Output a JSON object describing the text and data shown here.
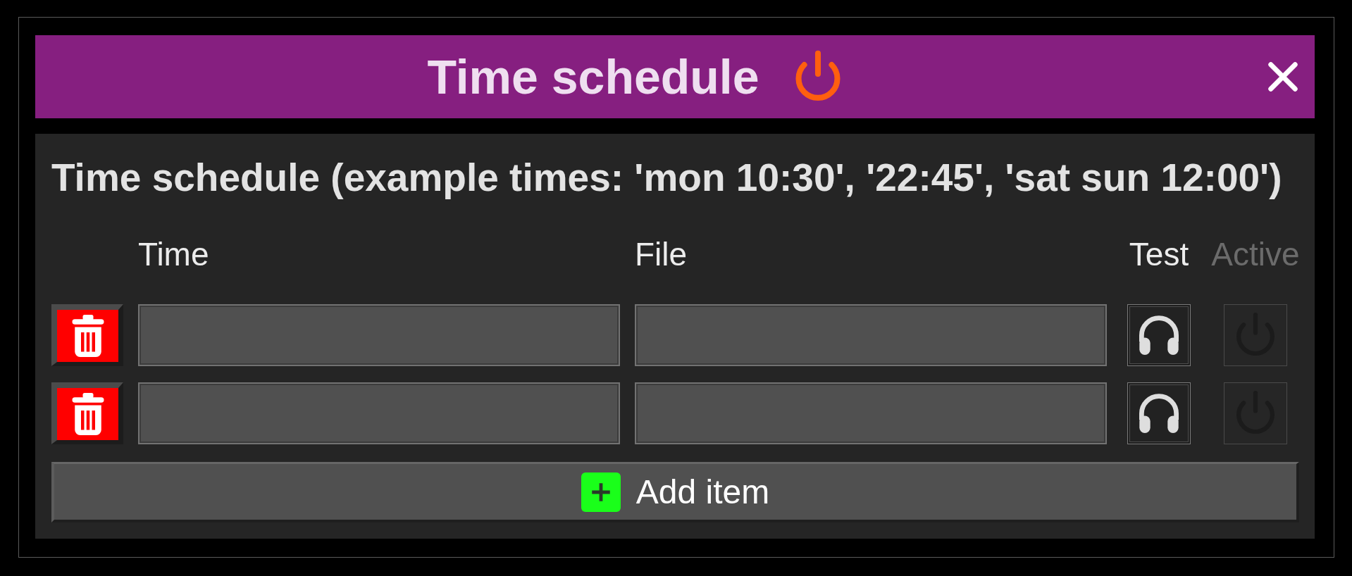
{
  "title_bar": {
    "title": "Time schedule",
    "power_on": true
  },
  "heading": "Time schedule (example times: 'mon 10:30', '22:45', 'sat sun 12:00')",
  "columns": [
    {
      "label": "Time",
      "disabled": false
    },
    {
      "label": "File",
      "disabled": false
    },
    {
      "label": "Test",
      "disabled": false
    },
    {
      "label": "Active",
      "disabled": true
    }
  ],
  "rows": [
    {
      "active_disabled": true
    },
    {
      "active_disabled": true
    }
  ],
  "add_button": {
    "label": "Add item"
  }
}
